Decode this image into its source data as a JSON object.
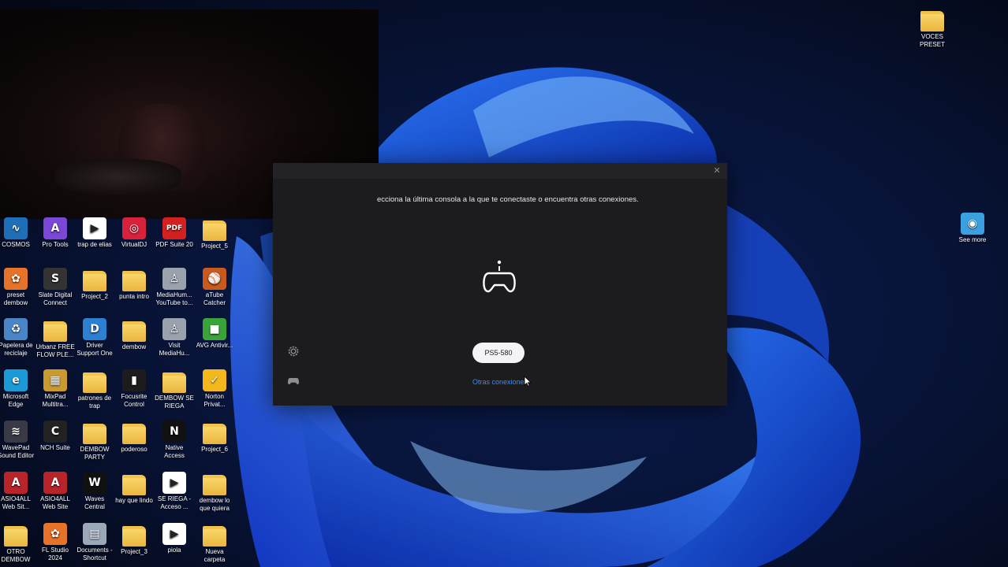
{
  "desktop": {
    "left_icons": [
      {
        "label": "COSMOS",
        "icon": "waveform-icon",
        "kind": "app",
        "color": "#1f6fb8"
      },
      {
        "label": "Pro Tools",
        "icon": "pro-tools-icon",
        "kind": "app",
        "color": "#7b47d6"
      },
      {
        "label": "trap de elias",
        "icon": "play-file-icon",
        "kind": "file",
        "color": "#ffffff"
      },
      {
        "label": "VirtualDJ",
        "icon": "virtualdj-icon",
        "kind": "app",
        "color": "#d8213b"
      },
      {
        "label": "PDF Suite 20",
        "icon": "pdf-icon",
        "kind": "app",
        "color": "#d32121"
      },
      {
        "label": "Project_5",
        "icon": "folder-icon",
        "kind": "folder",
        "color": "#f1c24d"
      },
      {
        "label": "preset dembow",
        "icon": "fl-studio-icon",
        "kind": "app",
        "color": "#e5732a"
      },
      {
        "label": "Slate Digital Connect",
        "icon": "slate-icon",
        "kind": "app",
        "color": "#333333"
      },
      {
        "label": "Project_2",
        "icon": "folder-icon",
        "kind": "folder",
        "color": "#f1c24d"
      },
      {
        "label": "punta intro",
        "icon": "folder-icon",
        "kind": "folder",
        "color": "#f1c24d"
      },
      {
        "label": "MediaHum... YouTube to...",
        "icon": "mediahuman-icon",
        "kind": "app",
        "color": "#9aa3ad"
      },
      {
        "label": "aTube Catcher",
        "icon": "atube-icon",
        "kind": "app",
        "color": "#c85a1e"
      },
      {
        "label": "Papelera de reciclaje",
        "icon": "recycle-bin-icon",
        "kind": "app",
        "color": "#4a86c7"
      },
      {
        "label": "Urbanz FREE FLOW PLE...",
        "icon": "folder-icon",
        "kind": "folder",
        "color": "#f1c24d"
      },
      {
        "label": "Driver Support One",
        "icon": "driver-icon",
        "kind": "app",
        "color": "#2c7fd1"
      },
      {
        "label": "dembow",
        "icon": "folder-icon",
        "kind": "folder",
        "color": "#f1c24d"
      },
      {
        "label": "Visit MediaHu...",
        "icon": "mediahuman-icon",
        "kind": "app",
        "color": "#9aa3ad"
      },
      {
        "label": "AVG Antivir...",
        "icon": "avg-icon",
        "kind": "app",
        "color": "#3aa33a"
      },
      {
        "label": "Microsoft Edge",
        "icon": "edge-icon",
        "kind": "app",
        "color": "#1a9bd7"
      },
      {
        "label": "MixPad Multitra...",
        "icon": "mixpad-icon",
        "kind": "app",
        "color": "#c99a2e"
      },
      {
        "label": "patrones de trap",
        "icon": "folder-icon",
        "kind": "folder",
        "color": "#f1c24d"
      },
      {
        "label": "Focusrite Control",
        "icon": "focusrite-icon",
        "kind": "app",
        "color": "#1c1c1c"
      },
      {
        "label": "DEMBOW SE RIEGA",
        "icon": "folder-icon",
        "kind": "folder",
        "color": "#f1c24d"
      },
      {
        "label": "Norton Privat...",
        "icon": "norton-icon",
        "kind": "app",
        "color": "#f2b81c"
      },
      {
        "label": "WavePad Sound Editor",
        "icon": "wavepad-icon",
        "kind": "app",
        "color": "#3a3a46"
      },
      {
        "label": "NCH Suite",
        "icon": "nch-icon",
        "kind": "app",
        "color": "#222222"
      },
      {
        "label": "DEMBOW PARTY",
        "icon": "folder-icon",
        "kind": "folder",
        "color": "#f1c24d"
      },
      {
        "label": "poderoso",
        "icon": "folder-icon",
        "kind": "folder",
        "color": "#f1c24d"
      },
      {
        "label": "Native Access",
        "icon": "native-access-icon",
        "kind": "app",
        "color": "#111111"
      },
      {
        "label": "Project_6",
        "icon": "folder-icon",
        "kind": "folder",
        "color": "#f1c24d"
      },
      {
        "label": "ASIO4ALL Web Sit...",
        "icon": "asio-icon",
        "kind": "app",
        "color": "#b8242a"
      },
      {
        "label": "ASIO4ALL Web Site",
        "icon": "asio-icon",
        "kind": "app",
        "color": "#b8242a"
      },
      {
        "label": "Waves Central",
        "icon": "waves-icon",
        "kind": "app",
        "color": "#111111"
      },
      {
        "label": "hay que lindo",
        "icon": "folder-icon",
        "kind": "folder",
        "color": "#f1c24d"
      },
      {
        "label": "SE RIEGA - Acceso ...",
        "icon": "play-file-icon",
        "kind": "file",
        "color": "#ffffff"
      },
      {
        "label": "dembow lo que quiera",
        "icon": "folder-icon",
        "kind": "folder",
        "color": "#f1c24d"
      },
      {
        "label": "OTRO DEMBOW",
        "icon": "folder-icon",
        "kind": "folder",
        "color": "#f1c24d"
      },
      {
        "label": "FL Studio 2024",
        "icon": "fl-studio-icon",
        "kind": "app",
        "color": "#e5732a"
      },
      {
        "label": "Documents - Shortcut",
        "icon": "documents-icon",
        "kind": "app",
        "color": "#9aa8b8"
      },
      {
        "label": "Project_3",
        "icon": "folder-icon",
        "kind": "folder",
        "color": "#f1c24d"
      },
      {
        "label": "piola",
        "icon": "play-file-icon",
        "kind": "file",
        "color": "#ffffff"
      },
      {
        "label": "Nueva carpeta",
        "icon": "folder-icon",
        "kind": "folder",
        "color": "#f1c24d"
      }
    ],
    "right_icons": [
      {
        "label": "VOCES PRESET",
        "icon": "folder-icon",
        "kind": "folder",
        "color": "#f1c24d"
      },
      {
        "label": "See more",
        "icon": "globe-icon",
        "kind": "app",
        "color": "#3ba0e0"
      }
    ]
  },
  "ps_remote_play": {
    "instruction": "ecciona la última consola a la que te conectaste o encuentra otras conexiones.",
    "console_button": "PS5-580",
    "other_connections": "Otras conexiones",
    "colors": {
      "window_bg": "#1c1c1f",
      "link": "#3f8bf0",
      "button_bg": "#f4f4f6"
    }
  }
}
